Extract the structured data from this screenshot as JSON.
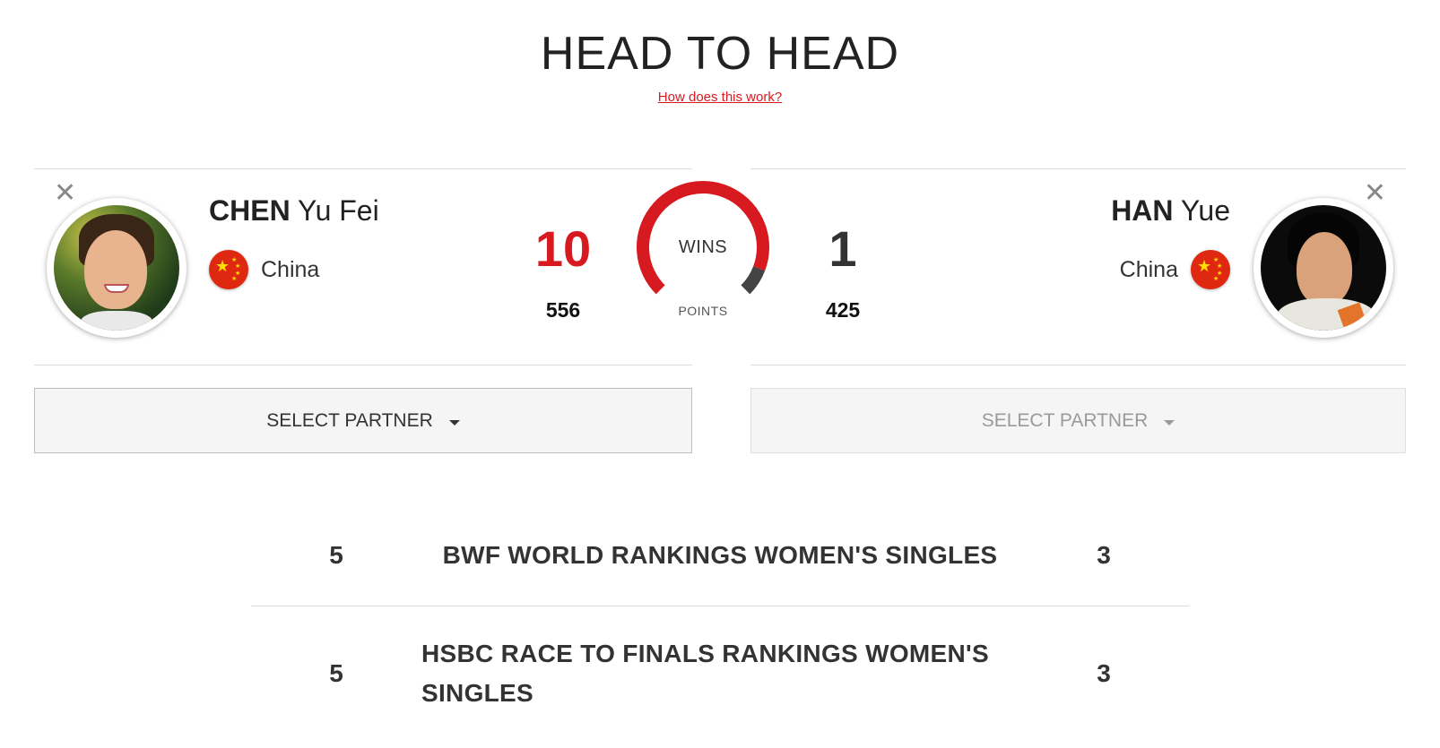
{
  "header": {
    "title": "HEAD TO HEAD",
    "help_link": "How does this work?"
  },
  "player_left": {
    "surname": "CHEN",
    "given_name": "Yu Fei",
    "country": "China",
    "wins": "10",
    "points": "556",
    "wins_color": "#d71920"
  },
  "player_right": {
    "surname": "HAN",
    "given_name": "Yue",
    "country": "China",
    "wins": "1",
    "points": "425",
    "wins_color": "#333333"
  },
  "gauge": {
    "label": "WINS",
    "sub_label": "POINTS",
    "left_color": "#d71920",
    "right_color": "#444444",
    "left_share": 0.91
  },
  "select_partner": {
    "left_label": "SELECT PARTNER",
    "right_label": "SELECT PARTNER"
  },
  "rankings": [
    {
      "left": "5",
      "label": "BWF WORLD RANKINGS WOMEN'S SINGLES",
      "right": "3"
    },
    {
      "left": "5",
      "label": "HSBC RACE TO FINALS RANKINGS WOMEN'S SINGLES",
      "right": "3"
    }
  ]
}
